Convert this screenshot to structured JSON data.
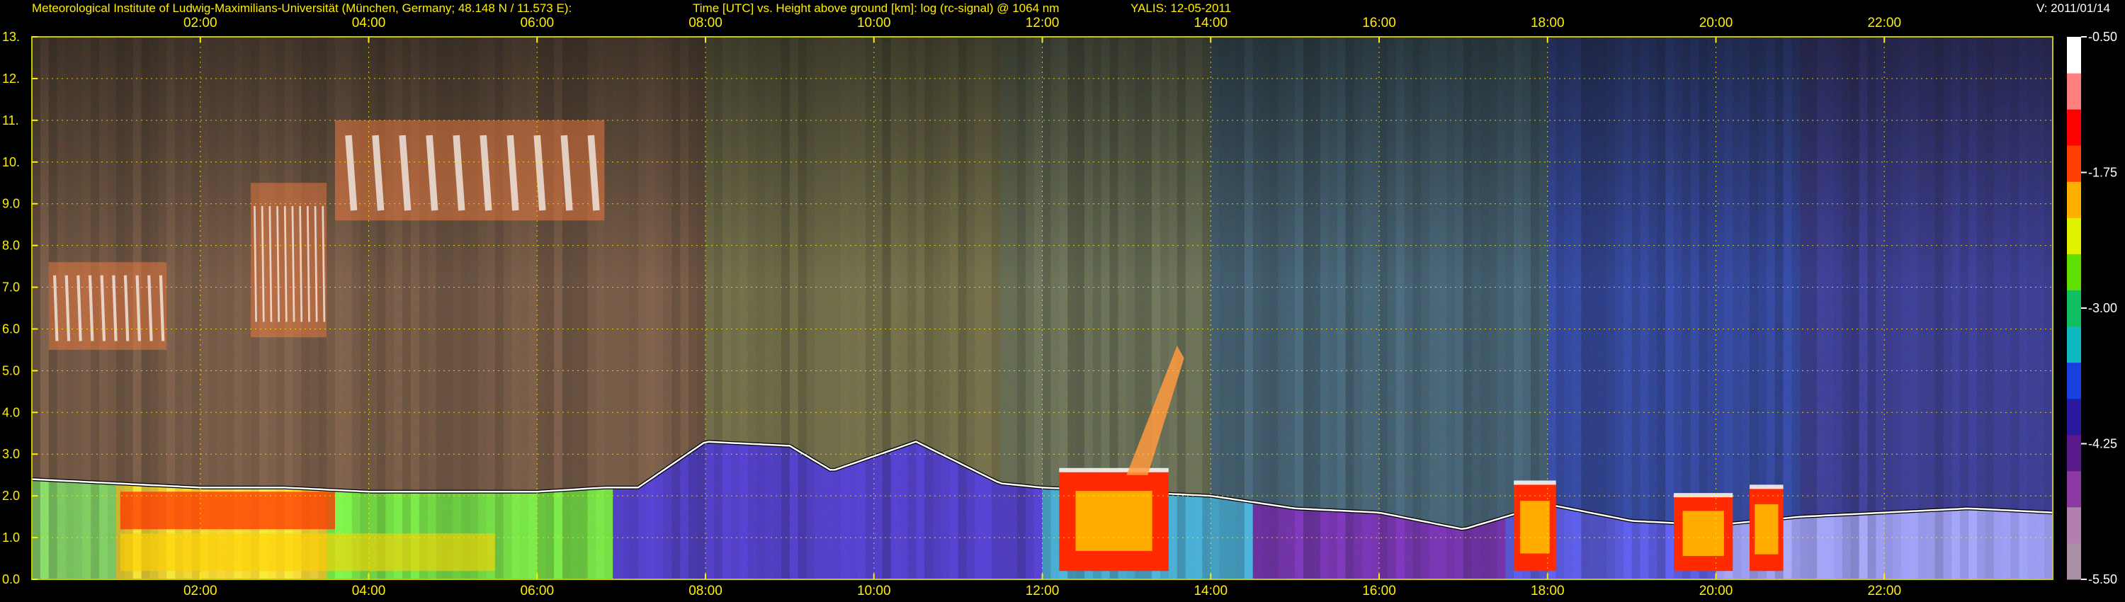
{
  "header": {
    "institute": "Meteorological Institute of Ludwig-Maximilians-Universität (München, Germany; 48.148 N / 11.573 E):",
    "axes_title": "Time [UTC] vs. Height above ground [km]: log (rc-signal) @ 1064 nm",
    "instrument_date": "YALIS: 12-05-2011",
    "version": "V: 2011/01/14"
  },
  "colors": {
    "axis_text": "#ffee00",
    "background": "#000000",
    "grid": "#ffee00",
    "plot_border": "#c8c800"
  },
  "chart_data": {
    "type": "heatmap",
    "title": "Time [UTC] vs. Height above ground [km]: log (rc-signal) @ 1064 nm",
    "xlabel": "Time [UTC]",
    "ylabel": "Height above ground [km]",
    "xlim_hours_utc": [
      0,
      24
    ],
    "ylim_km": [
      0,
      13
    ],
    "x_ticks": [
      "02:00",
      "04:00",
      "06:00",
      "08:00",
      "10:00",
      "12:00",
      "14:00",
      "16:00",
      "18:00",
      "20:00",
      "22:00"
    ],
    "x_tick_hours": [
      2,
      4,
      6,
      8,
      10,
      12,
      14,
      16,
      18,
      20,
      22
    ],
    "y_ticks": [
      "0.0",
      "1.0",
      "2.0",
      "3.0",
      "4.0",
      "5.0",
      "6.0",
      "7.0",
      "8.0",
      "9.0",
      "10.",
      "11.",
      "12.",
      "13."
    ],
    "y_tick_values": [
      0,
      1,
      2,
      3,
      4,
      5,
      6,
      7,
      8,
      9,
      10,
      11,
      12,
      13
    ],
    "grid": true,
    "colorbar": {
      "range": [
        -5.5,
        -0.5
      ],
      "tick_labels": [
        "-0.50",
        "-1.75",
        "-3.00",
        "-4.25",
        "-5.50"
      ],
      "tick_values": [
        -0.5,
        -1.75,
        -3.0,
        -4.25,
        -5.5
      ],
      "palette": [
        "#a890a8",
        "#b080b0",
        "#8a3aa0",
        "#5a1a8a",
        "#2a18a0",
        "#1840e0",
        "#10b8c0",
        "#10c060",
        "#60e000",
        "#e0f000",
        "#ffb000",
        "#ff4000",
        "#ff0000",
        "#ff8080",
        "#ffffff"
      ]
    },
    "features": {
      "boundary_layer_top_km": [
        [
          0.0,
          2.4
        ],
        [
          1.0,
          2.3
        ],
        [
          2.0,
          2.2
        ],
        [
          3.0,
          2.2
        ],
        [
          4.0,
          2.1
        ],
        [
          5.0,
          2.1
        ],
        [
          6.0,
          2.1
        ],
        [
          6.8,
          2.2
        ],
        [
          7.2,
          2.2
        ],
        [
          8.0,
          3.3
        ],
        [
          9.0,
          3.2
        ],
        [
          9.5,
          2.6
        ],
        [
          10.5,
          3.3
        ],
        [
          11.5,
          2.3
        ],
        [
          12.0,
          2.2
        ],
        [
          13.0,
          2.1
        ],
        [
          14.0,
          2.0
        ],
        [
          15.0,
          1.7
        ],
        [
          16.0,
          1.6
        ],
        [
          17.0,
          1.2
        ],
        [
          18.0,
          1.8
        ],
        [
          19.0,
          1.4
        ],
        [
          20.0,
          1.3
        ],
        [
          21.0,
          1.5
        ],
        [
          22.0,
          1.6
        ],
        [
          23.0,
          1.7
        ],
        [
          24.0,
          1.6
        ]
      ],
      "cirrus_layers": [
        {
          "t_start": 0.2,
          "t_end": 1.6,
          "h_bottom": 5.5,
          "h_top": 7.6
        },
        {
          "t_start": 2.6,
          "t_end": 3.5,
          "h_bottom": 5.8,
          "h_top": 9.5
        },
        {
          "t_start": 3.6,
          "t_end": 6.8,
          "h_bottom": 8.6,
          "h_top": 11.0
        }
      ],
      "convective_cells": [
        {
          "t_start": 12.2,
          "t_end": 13.5,
          "h_top": 2.6
        },
        {
          "t_start": 17.6,
          "t_end": 18.1,
          "h_top": 2.3
        },
        {
          "t_start": 19.5,
          "t_end": 20.2,
          "h_top": 2.0
        },
        {
          "t_start": 20.4,
          "t_end": 20.8,
          "h_top": 2.2
        }
      ],
      "convective_plume": {
        "t_start": 13.0,
        "t_end": 13.6,
        "h_bottom": 2.5,
        "h_top": 5.6
      }
    }
  }
}
